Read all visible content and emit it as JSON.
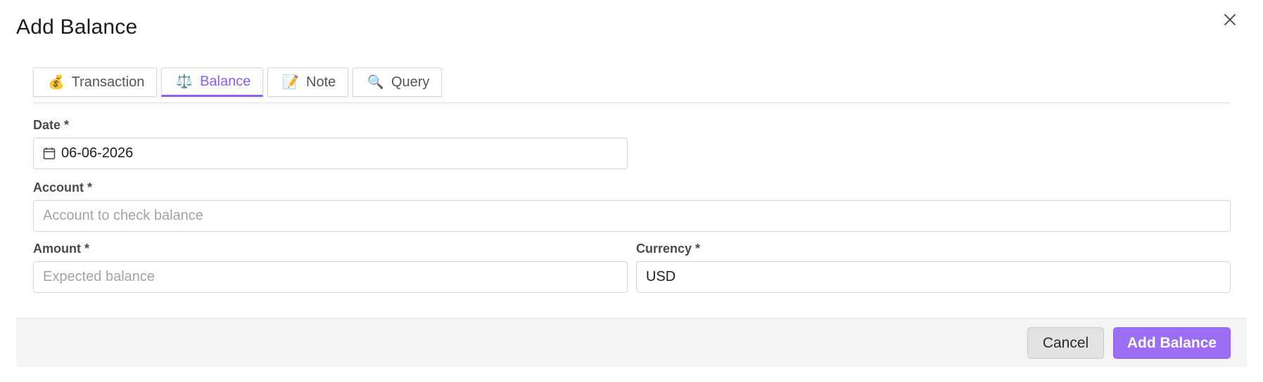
{
  "dialog": {
    "title": "Add Balance",
    "close_icon": "close-icon"
  },
  "tabs": [
    {
      "label": "Transaction",
      "icon": "money-bag-icon",
      "glyph": "💰",
      "active": false
    },
    {
      "label": "Balance",
      "icon": "balance-scale-icon",
      "glyph": "⚖️",
      "active": true
    },
    {
      "label": "Note",
      "icon": "memo-icon",
      "glyph": "📝",
      "active": false
    },
    {
      "label": "Query",
      "icon": "magnifier-icon",
      "glyph": "🔍",
      "active": false
    }
  ],
  "form": {
    "date": {
      "label": "Date *",
      "value": "06-06-2026",
      "icon": "calendar-icon"
    },
    "account": {
      "label": "Account *",
      "value": "",
      "placeholder": "Account to check balance"
    },
    "amount": {
      "label": "Amount *",
      "value": "",
      "placeholder": "Expected balance"
    },
    "currency": {
      "label": "Currency *",
      "value": "USD"
    }
  },
  "footer": {
    "cancel_label": "Cancel",
    "submit_label": "Add Balance"
  },
  "colors": {
    "accent": "#8b5cf6",
    "primary_button": "#9b6ef5",
    "footer_bg": "#f4f4f4",
    "border": "#d5d5d5"
  }
}
